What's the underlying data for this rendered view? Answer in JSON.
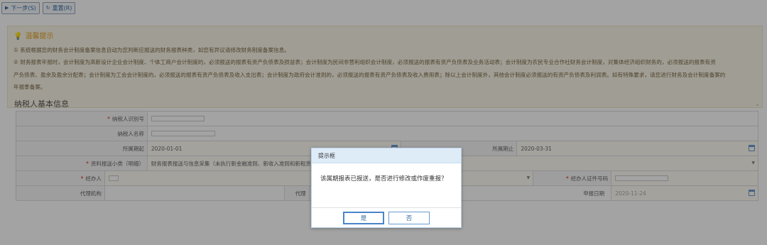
{
  "toolbar": {
    "next_label": "下一步(S)",
    "reset_label": "重置(R)"
  },
  "tips": {
    "title": "温馨提示",
    "line1": "① 系统根据您的财务会计制度备案信息自动为您判断应报送的财务报表种类，如您有异议请修改财务制度备案信息。",
    "line2": "② 财务报表年报时，会计制度为高新设计企业会计制度、个体工商户会计制度的，必须报送的报表有资产负债表及损益表；会计制度为民间非营利组织会计制度，必须报送的报表有资产负债表及业务活动表；会计制度为农民专业合作社财务会计制度，对集体经济组织财务的，必须报送的报表有资",
    "line3": "产负债表、盈余及盈余分配表；会计制度为工会会计制度的，必须报送的报表有资产负债表及收入支出表；会计制度为政府会计准则的，必须报送的报表有资产负债表及收入费用表；除以上会计制度外，其他会计制度必须报送的有资产负债表及利润表。如有特殊要求，请您进行财务及会计制度备案的",
    "line4": "年报季备案。"
  },
  "section": {
    "title": "纳税人基本信息"
  },
  "form": {
    "taxpayer_id_label": "纳税人识别号",
    "taxpayer_name_label": "纳税人名称",
    "period_start_label": "所属期起",
    "period_start_value": "2020-01-01",
    "period_end_label": "所属期止",
    "period_end_value": "2020-03-31",
    "doc_type_label": "资料报送小类（明细）",
    "doc_type_value": "财务报表报送与信息采集（未执行新金融准则、新收入准则和新租赁",
    "agent_label": "经办人",
    "agent_id_label": "经办人证件号码",
    "proxy_org_label": "代理机构",
    "proxy_label": "代理",
    "report_date_label": "申报日期",
    "report_date_value": "2020-11-24"
  },
  "dialog": {
    "title": "提示框",
    "message": "该属期报表已报送，是否进行修改或作废重报？",
    "yes_label": "是",
    "no_label": "否"
  },
  "colors": {
    "overlay": "#000000",
    "dialog_header": "#deecf8",
    "button_border": "#4a84c8"
  }
}
